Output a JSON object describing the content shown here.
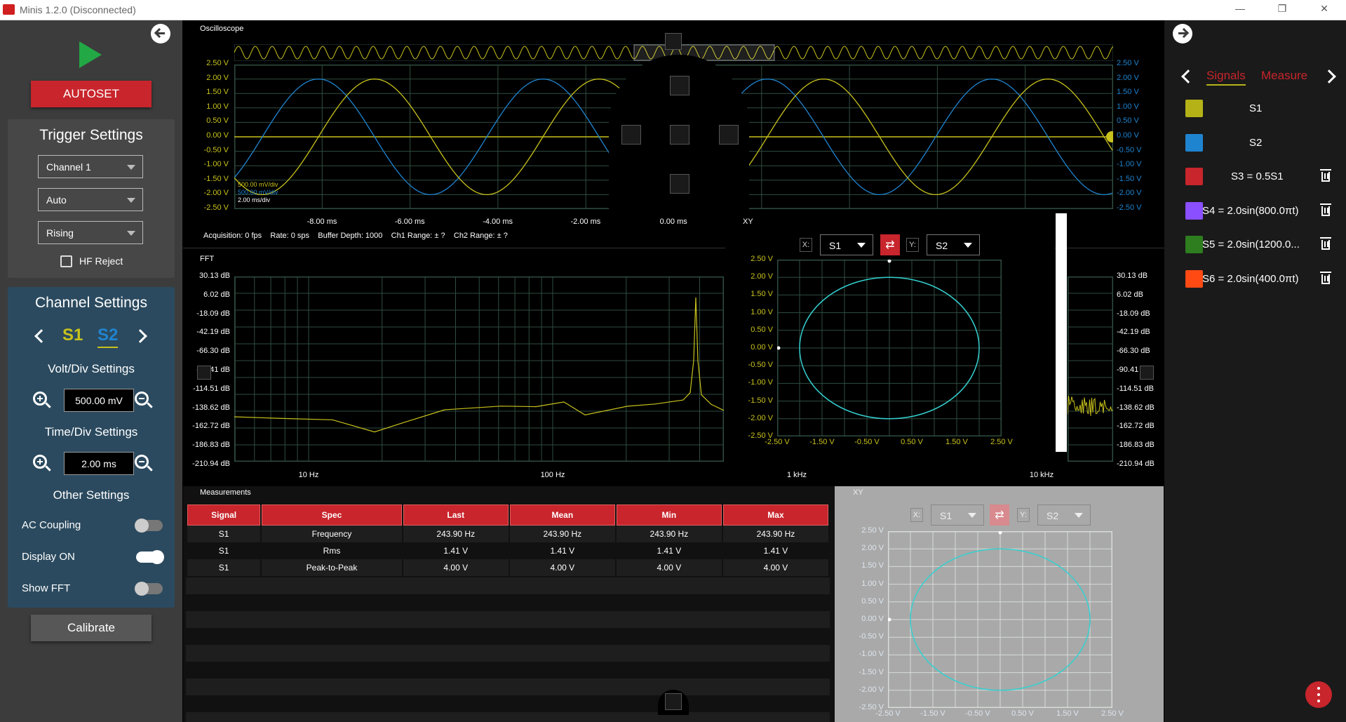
{
  "window": {
    "title": "Minis 1.2.0 (Disconnected)"
  },
  "left": {
    "autoset": "AUTOSET",
    "trigger": {
      "title": "Trigger Settings",
      "channel": "Channel 1",
      "mode": "Auto",
      "edge": "Rising",
      "hf_reject": "HF Reject"
    },
    "channel": {
      "title": "Channel Settings",
      "s1": "S1",
      "s2": "S2",
      "volt_title": "Volt/Div Settings",
      "volt_value": "500.00 mV",
      "time_title": "Time/Div Settings",
      "time_value": "2.00 ms",
      "other_title": "Other Settings",
      "ac_coupling": "AC Coupling",
      "display_on": "Display ON",
      "show_fft": "Show FFT"
    },
    "calibrate": "Calibrate"
  },
  "scope": {
    "title": "Oscilloscope",
    "y_ticks": [
      "2.50 V",
      "2.00 V",
      "1.50 V",
      "1.00 V",
      "0.50 V",
      "0.00 V",
      "-0.50 V",
      "-1.00 V",
      "-1.50 V",
      "-2.00 V",
      "-2.50 V"
    ],
    "x_ticks": [
      "-8.00 ms",
      "-6.00 ms",
      "-4.00 ms",
      "-2.00 ms",
      "0.00 ms"
    ],
    "div_labels": [
      "500.00 mV/div",
      "500.00 mV/div",
      "2.00 ms/div"
    ],
    "status": {
      "acq": "Acquisition: 0 fps",
      "rate": "Rate: 0 sps",
      "buffer": "Buffer Depth: 1000",
      "ch1": "Ch1 Range: ± ?",
      "ch2": "Ch2 Range: ± ?"
    }
  },
  "fft": {
    "title": "FFT",
    "y_ticks": [
      "30.13 dB",
      "6.02 dB",
      "-18.09 dB",
      "-42.19 dB",
      "-66.30 dB",
      "-90.41 dB",
      "-114.51 dB",
      "-138.62 dB",
      "-162.72 dB",
      "-186.83 dB",
      "-210.94 dB"
    ],
    "x_ticks": [
      "10 Hz",
      "100 Hz",
      "1 kHz",
      "10 kHz"
    ]
  },
  "xy": {
    "title": "XY",
    "x_tag": "X:",
    "y_tag": "Y:",
    "x_sel": "S1",
    "y_sel": "S2",
    "swap": "⇄",
    "y_ticks": [
      "2.50 V",
      "2.00 V",
      "1.50 V",
      "1.00 V",
      "0.50 V",
      "0.00 V",
      "-0.50 V",
      "-1.00 V",
      "-1.50 V",
      "-2.00 V",
      "-2.50 V"
    ],
    "x_ticks": [
      "-2.50 V",
      "-1.50 V",
      "-0.50 V",
      "0.50 V",
      "1.50 V",
      "2.50 V"
    ]
  },
  "measurements": {
    "title": "Measurements",
    "headers": [
      "Signal",
      "Spec",
      "Last",
      "Mean",
      "Min",
      "Max"
    ],
    "rows": [
      [
        "S1",
        "Frequency",
        "243.90 Hz",
        "243.90 Hz",
        "243.90 Hz",
        "243.90 Hz"
      ],
      [
        "S1",
        "Rms",
        "1.41 V",
        "1.41 V",
        "1.41 V",
        "1.41 V"
      ],
      [
        "S1",
        "Peak-to-Peak",
        "4.00 V",
        "4.00 V",
        "4.00 V",
        "4.00 V"
      ]
    ]
  },
  "right": {
    "tab_signals": "Signals",
    "tab_measure": "Measure",
    "signals": [
      {
        "label": "S1",
        "color": "#b5b218",
        "deletable": false
      },
      {
        "label": "S2",
        "color": "#1f84d0",
        "deletable": false
      },
      {
        "label": "S3 = 0.5S1",
        "color": "#c8252c",
        "deletable": true
      },
      {
        "label": "S4 = 2.0sin(800.0πt)",
        "color": "#8a4fff",
        "deletable": true
      },
      {
        "label": "S5 = 2.0sin(1200.0...",
        "color": "#2e7d1f",
        "deletable": true
      },
      {
        "label": "S6 = 2.0sin(400.0πt)",
        "color": "#ff4a14",
        "deletable": true
      }
    ]
  },
  "colors": {
    "accent": "#c8252c",
    "ch1": "#c8c21c",
    "ch2": "#1f84d0",
    "xy": "#35d0d0",
    "grid": "#3a5a4a"
  }
}
